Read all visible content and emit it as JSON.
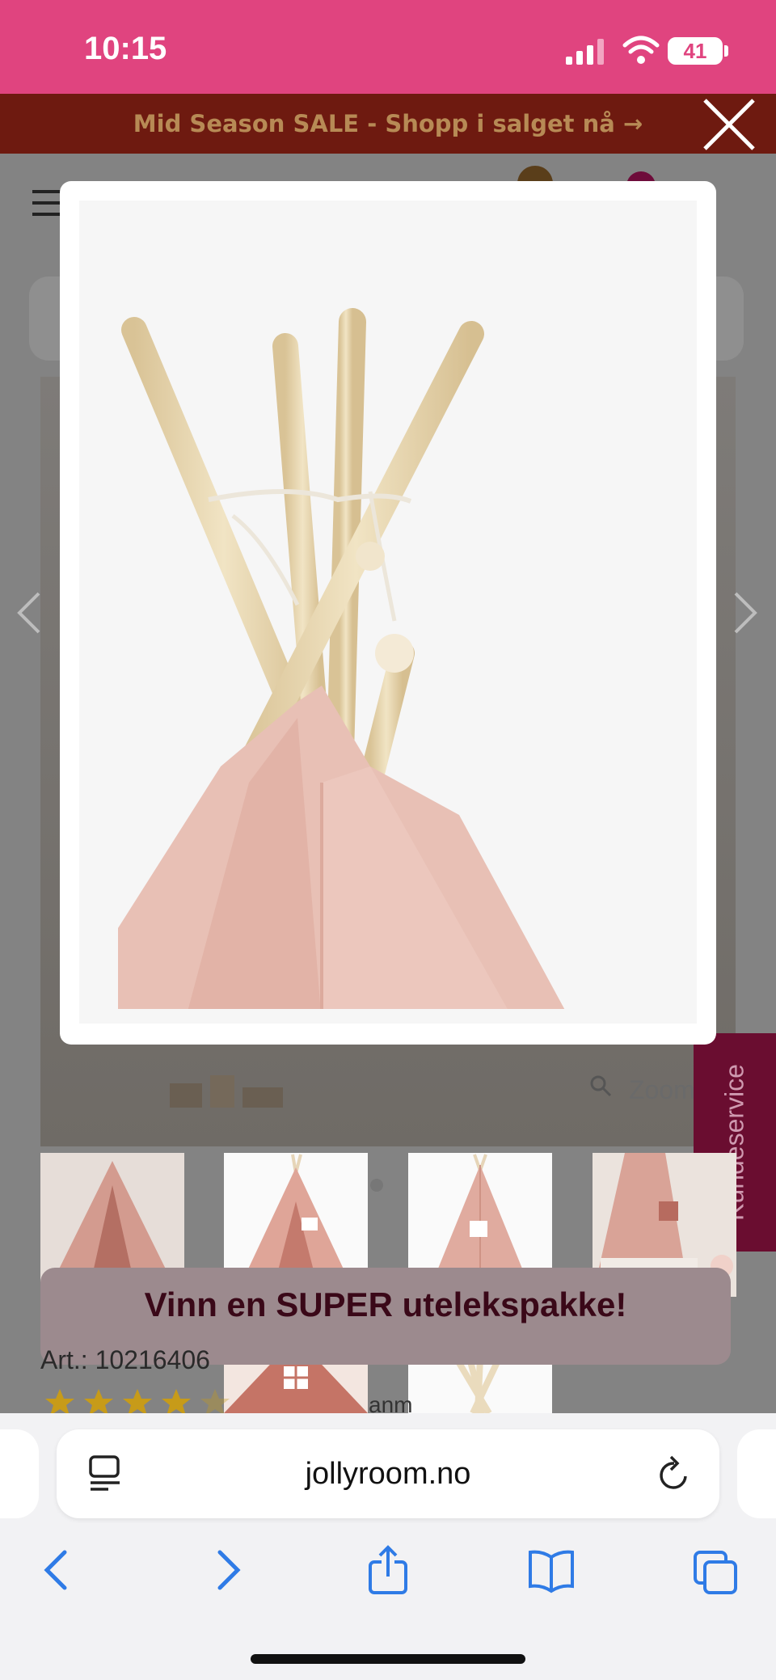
{
  "status_bar": {
    "time": "10:15",
    "battery": "41"
  },
  "promo_banner": {
    "text": "Mid Season SALE - Shopp i salget nå →"
  },
  "modal": {
    "image_name": "tipi-top-closeup"
  },
  "background": {
    "zoom_label": "Zoom",
    "kundeservice": "Kundeservice",
    "promo_text": "Vinn en SUPER utelekspakke!",
    "art_text": "Art.: 10216406",
    "anm_text": "anm",
    "rating_stars": 4,
    "thumbnails": [
      "tipi-room-1",
      "tipi-white-front",
      "tipi-white-side",
      "tipi-room-2",
      "tipi-window-close",
      "tipi-poles-top"
    ]
  },
  "browser": {
    "url": "jollyroom.no"
  },
  "colors": {
    "accent_pink": "#e0447f",
    "banner_bg": "#6e1a10",
    "banner_text": "#b78a55",
    "browser_link": "#2f7be6"
  }
}
